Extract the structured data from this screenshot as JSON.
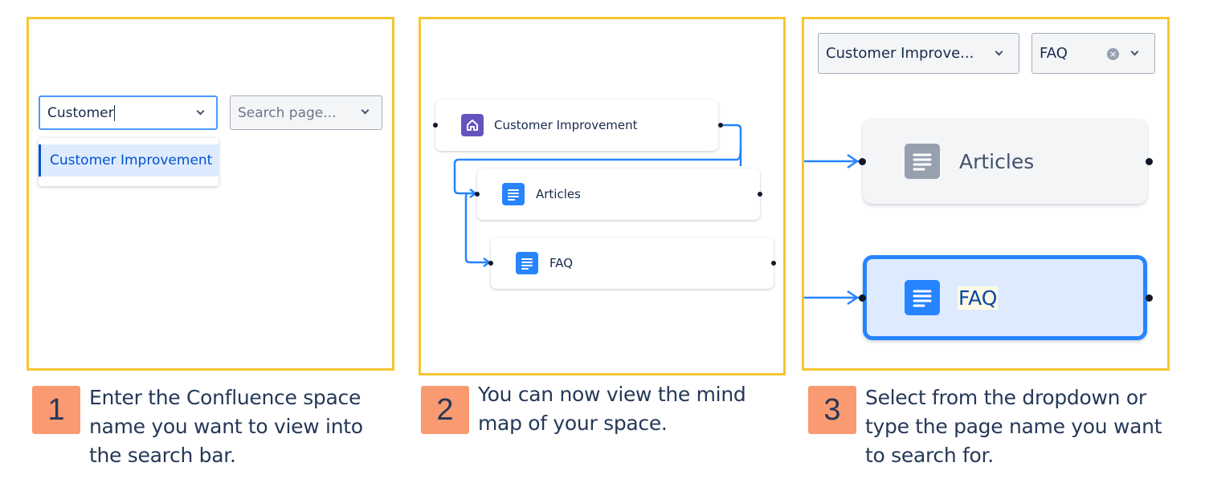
{
  "panels": [
    {
      "step_number": "1",
      "caption": "Enter the Confluence space name you want to view into the search bar.",
      "space_select": {
        "value": "Customer"
      },
      "page_select": {
        "placeholder": "Search page..."
      },
      "dropdown_options": [
        "Customer Improvement"
      ]
    },
    {
      "step_number": "2",
      "caption": "You can now view the mind map of your space.",
      "nodes": [
        {
          "label": "Customer Improvement",
          "icon": "home-icon",
          "icon_color": "#6554C0"
        },
        {
          "label": "Articles",
          "icon": "page-icon",
          "icon_color": "#2684FF"
        },
        {
          "label": "FAQ",
          "icon": "page-icon",
          "icon_color": "#2684FF"
        }
      ]
    },
    {
      "step_number": "3",
      "caption": "Select from the dropdown or type the page name you want to search for.",
      "space_select": {
        "value": "Customer Improve..."
      },
      "page_select": {
        "value": "FAQ"
      },
      "nodes": [
        {
          "label": "Articles",
          "icon": "page-icon",
          "state": "default"
        },
        {
          "label": "FAQ",
          "icon": "page-icon",
          "state": "selected"
        }
      ]
    }
  ],
  "colors": {
    "panel_border": "#F5C62F",
    "step_badge": "#F99A70",
    "connector": "#2684FF",
    "selected_node_bg": "#DEEBFF"
  }
}
